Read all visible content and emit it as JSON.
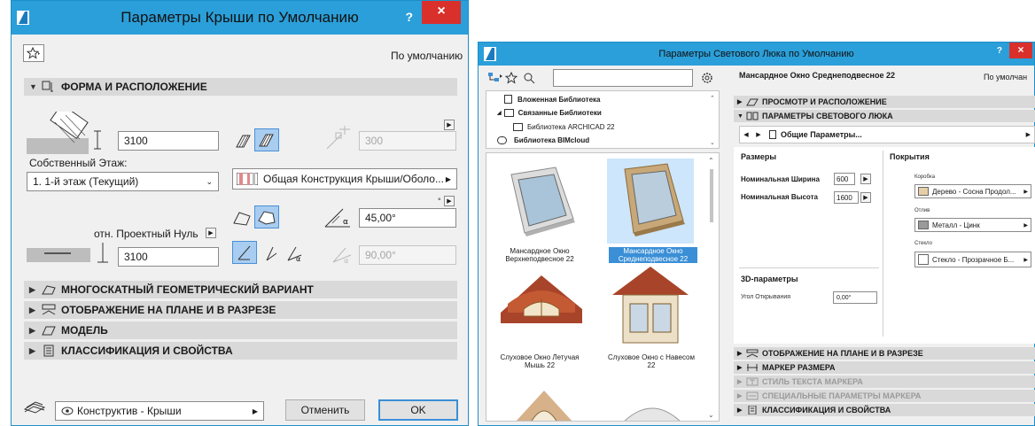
{
  "roof_dialog": {
    "title": "Параметры Крыши по Умолчанию",
    "help": "?",
    "close": "×",
    "default_label": "По умолчанию",
    "sections": [
      {
        "label": "ФОРМА И РАСПОЛОЖЕНИЕ",
        "expanded": true
      },
      {
        "label": "МНОГОСКАТНЫЙ ГЕОМЕТРИЧЕСКИЙ ВАРИАНТ",
        "expanded": false
      },
      {
        "label": "ОТОБРАЖЕНИЕ НА ПЛАНЕ И В РАЗРЕЗЕ",
        "expanded": false
      },
      {
        "label": "МОДЕЛЬ",
        "expanded": false
      },
      {
        "label": "КЛАССИФИКАЦИЯ И СВОЙСТВА",
        "expanded": false
      }
    ],
    "thickness": "3100",
    "offset_disabled": "300",
    "home_story_label": "Собственный Этаж:",
    "home_story_value": "1. 1-й этаж (Текущий)",
    "composite": "Общая Конструкция Крыши/Оболо...",
    "ref_label": "отн. Проектный Нуль",
    "elevation": "3100",
    "pitch": "45,00°",
    "angle_disabled": "90,00°",
    "layer": "Конструктив - Крыши",
    "cancel": "Отменить",
    "ok": "OK"
  },
  "skylight_dialog": {
    "title": "Параметры Светового Люка по Умолчанию",
    "help": "?",
    "close": "×",
    "search_placeholder": "",
    "tree": [
      "Вложенная Библиотека",
      "Связанные Библиотеки",
      "Библиотека ARCHICAD 22",
      "Библиотека BIMcloud"
    ],
    "tiles": [
      "Мансардное Окно Верхнеподвесное 22",
      "Мансардное Окно Среднеподвесное 22",
      "Слуховое Окно Летучая Мышь 22",
      "Слуховое Окно с Навесом 22"
    ],
    "object_name": "Мансардное Окно Среднеподвесное 22",
    "default_label": "По умолчан",
    "sec_top": [
      {
        "label": "ПРОСМОТР И РАСПОЛОЖЕНИЕ",
        "expanded": false
      },
      {
        "label": "ПАРАМЕТРЫ СВЕТОВОГО ЛЮКА",
        "expanded": true
      }
    ],
    "nav_label": "Общие Параметры...",
    "sizes_header": "Размеры",
    "width_label": "Номинальная Ширина",
    "width_value": "600",
    "height_label": "Номинальная Высота",
    "height_value": "1600",
    "params3d_header": "3D-параметры",
    "open_angle_label": "Угол Открывания",
    "open_angle_value": "0,00°",
    "surfaces_header": "Покрытия",
    "frame_label": "Коробка",
    "frame_value": "Дерево - Сосна Продол...",
    "trim_label": "Отлив",
    "trim_value": "Металл - Цинк",
    "glass_label": "Стекло",
    "glass_value": "Стекло - Прозрачное Б...",
    "sec_bottom": [
      {
        "label": "ОТОБРАЖЕНИЕ НА ПЛАНЕ И В РАЗРЕЗЕ",
        "disabled": false
      },
      {
        "label": "МАРКЕР РАЗМЕРА",
        "disabled": false
      },
      {
        "label": "СТИЛЬ ТЕКСТА МАРКЕРА",
        "disabled": true
      },
      {
        "label": "СПЕЦИАЛЬНЫЕ ПАРАМЕТРЫ МАРКЕРА",
        "disabled": true
      },
      {
        "label": "КЛАССИФИКАЦИЯ И СВОЙСТВА",
        "disabled": false
      }
    ]
  },
  "colors": {
    "titlebar": "#2b9fd9",
    "close": "#d9302c",
    "accent": "#3a8fd6"
  }
}
